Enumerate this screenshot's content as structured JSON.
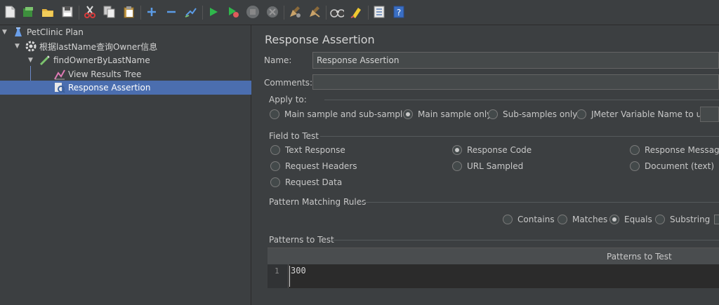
{
  "colors": {
    "background": "#3c3f41",
    "selection": "#4b6eaf",
    "input_bg": "#45494a",
    "editor_bg": "#2b2b2b",
    "run_green": "#2fb74c",
    "add_blue": "#5b9be6"
  },
  "toolbar": {
    "icons": [
      "new-icon",
      "templates-icon",
      "open-icon",
      "save-icon",
      "cut-icon",
      "copy-icon",
      "paste-icon",
      "expand-icon",
      "collapse-icon",
      "toggle-icon",
      "start-icon",
      "start-no-pauses-icon",
      "stop-icon",
      "shutdown-icon",
      "clear-icon",
      "clear-all-icon",
      "search-icon",
      "reset-search-icon",
      "function-helper-icon",
      "help-icon"
    ]
  },
  "tree": {
    "items": [
      {
        "label": "PetClinic Plan",
        "icon": "test-plan-icon"
      },
      {
        "label": "根据lastName查询Owner信息",
        "icon": "thread-group-icon"
      },
      {
        "label": "findOwnerByLastName",
        "icon": "http-sampler-icon"
      },
      {
        "label": "View Results Tree",
        "icon": "listener-icon"
      },
      {
        "label": "Response Assertion",
        "icon": "assertion-icon"
      }
    ]
  },
  "panel": {
    "title": "Response Assertion",
    "name_label": "Name:",
    "name_value": "Response Assertion",
    "comments_label": "Comments:",
    "comments_value": "",
    "apply_to": {
      "label": "Apply to:",
      "options": [
        "Main sample and sub-samples",
        "Main sample only",
        "Sub-samples only",
        "JMeter Variable Name to use"
      ],
      "selected": "Main sample only"
    },
    "field_to_test": {
      "label": "Field to Test",
      "options": [
        "Text Response",
        "Response Code",
        "Response Message",
        "Request Headers",
        "URL Sampled",
        "Document (text)",
        "Request Data"
      ],
      "selected": "Response Code"
    },
    "pattern_rules": {
      "label": "Pattern Matching Rules",
      "options": [
        "Contains",
        "Matches",
        "Equals",
        "Substring"
      ],
      "selected": "Equals"
    },
    "patterns": {
      "label": "Patterns to Test",
      "column_header": "Patterns to Test",
      "line_number": "1",
      "value": "300"
    }
  }
}
